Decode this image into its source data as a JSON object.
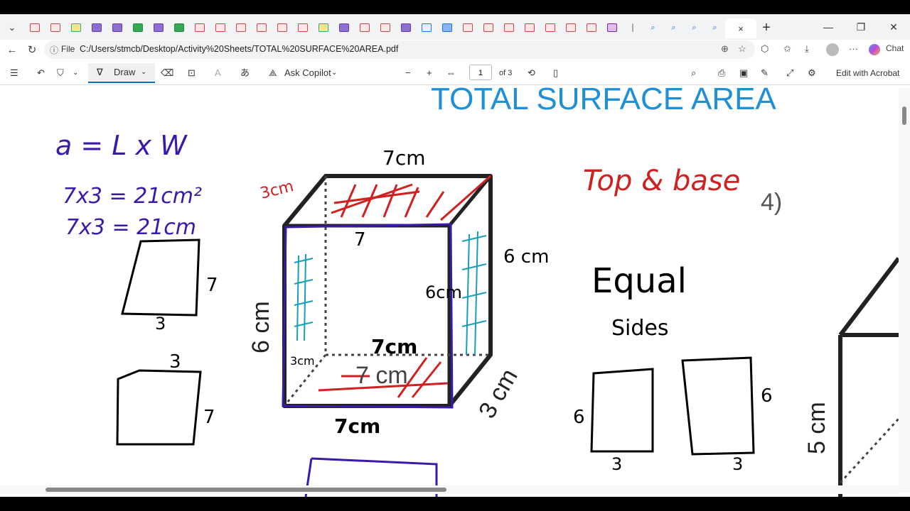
{
  "browser": {
    "url_scheme_label": "File",
    "url": "C:/Users/stmcb/Desktop/Activity%20Sheets/TOTAL%20SURFACE%20AREA.pdf",
    "active_tab_close": "×",
    "new_tab": "+",
    "chat_label": "Chat",
    "more_label": "···"
  },
  "pdf_toolbar": {
    "draw_label": "Draw",
    "copilot_label": "Ask Copilot",
    "page_number": "1",
    "page_total": "of 3",
    "acrobat_label": "Edit with Acrobat"
  },
  "document": {
    "title": "TOTAL SURFACE AREA",
    "formula": "a = L x W",
    "calc1": "7x3 = 21cm²",
    "calc2": "7x3 = 21cm",
    "rect1_side": "7",
    "rect1_bottom": "3",
    "rect2_top": "3",
    "rect2_side": "7",
    "cube_top": "7cm",
    "cube_corner": "3cm",
    "cube_top_inner": "7",
    "cube_right_outer": "6 cm",
    "cube_right_inner": "6cm",
    "cube_left_printed": "6 cm",
    "cube_bottom_inner": "7cm",
    "cube_bottom_printed": "7 cm",
    "cube_bottom_outer": "7cm",
    "cube_inner_small": "3cm",
    "cube_depth_printed": "3 cm",
    "top_base_note": "Top & base",
    "problem_number": "4)",
    "equal_word": "Equal",
    "sides_word": "Sides",
    "rect3_side": "6",
    "rect3_bottom": "3",
    "rect4_side": "6",
    "rect4_bottom": "3",
    "right_printed": "5 cm"
  }
}
